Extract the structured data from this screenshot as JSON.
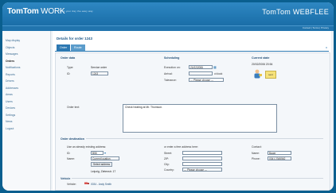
{
  "header": {
    "logo_bold": "TomTom",
    "logo_thin": " WORK",
    "tagline": "Plan your day the easy way",
    "brand": "TomTom WEBFLEE",
    "links": "Contact | Terms | Privacy"
  },
  "sidebar": {
    "items": [
      {
        "label": "Map display",
        "active": false
      },
      {
        "label": "Objects",
        "active": false
      },
      {
        "label": "Messages",
        "active": false
      },
      {
        "label": "Orders",
        "active": true
      },
      {
        "label": "Notifications",
        "active": false
      },
      {
        "label": "Reports",
        "active": false
      },
      {
        "label": "Drivers",
        "active": false
      },
      {
        "label": "Addresses",
        "active": false
      },
      {
        "label": "Areas",
        "active": false
      },
      {
        "label": "Users",
        "active": false
      },
      {
        "label": "Devices",
        "active": false
      },
      {
        "label": "Settings",
        "active": false
      },
      {
        "label": "News",
        "active": false
      },
      {
        "label": "Logout",
        "active": false
      }
    ]
  },
  "main": {
    "title": "Details for order 1243",
    "tabs": [
      "Order",
      "Route"
    ],
    "tab_close": "x",
    "order_data": {
      "section": "Order data",
      "type_label": "Type:",
      "type_value": "Service order",
      "id_label": "ID:",
      "id_value": "1243"
    },
    "scheduling": {
      "section": "Scheduling",
      "execution_label": "Execution on:",
      "execution_value": "21/02/2006",
      "arrival_label": "Arrival:",
      "arrival_unit": "o'clock",
      "tolerance_label": "Tolerance:",
      "tolerance_value": "--- Please choose ---"
    },
    "current_state": {
      "section": "Current state",
      "datetime": "20/02/2006 20:54",
      "badge": "sent"
    },
    "order_text": {
      "label": "Order text:",
      "value": "Check heating at Mr. Thomson."
    },
    "destination": {
      "section": "Order destination",
      "existing_label": "Use an already existing address:",
      "id_label": "ID:",
      "id_value": "B55",
      "name_label": "Name:",
      "name_value": "Current location",
      "select_button": "Select address",
      "address_line": "Leipzig, Zietenstr. 17",
      "free_label": "or enter a free address here:",
      "street_label": "Street:",
      "zip_label": "ZIP:",
      "city_label": "City:",
      "country_label": "Country:",
      "country_value": "--- Please choose ---",
      "contact_label": "Contact:",
      "contact_name_label": "Name:",
      "contact_name_value": "Bauer",
      "phone_label": "Phone:",
      "phone_value": "0341 2345562"
    },
    "vehicles": {
      "section": "Vehicle",
      "vehicle_label": "Vehicle:",
      "vehicle_value": "0034 - Andy Smith"
    }
  }
}
